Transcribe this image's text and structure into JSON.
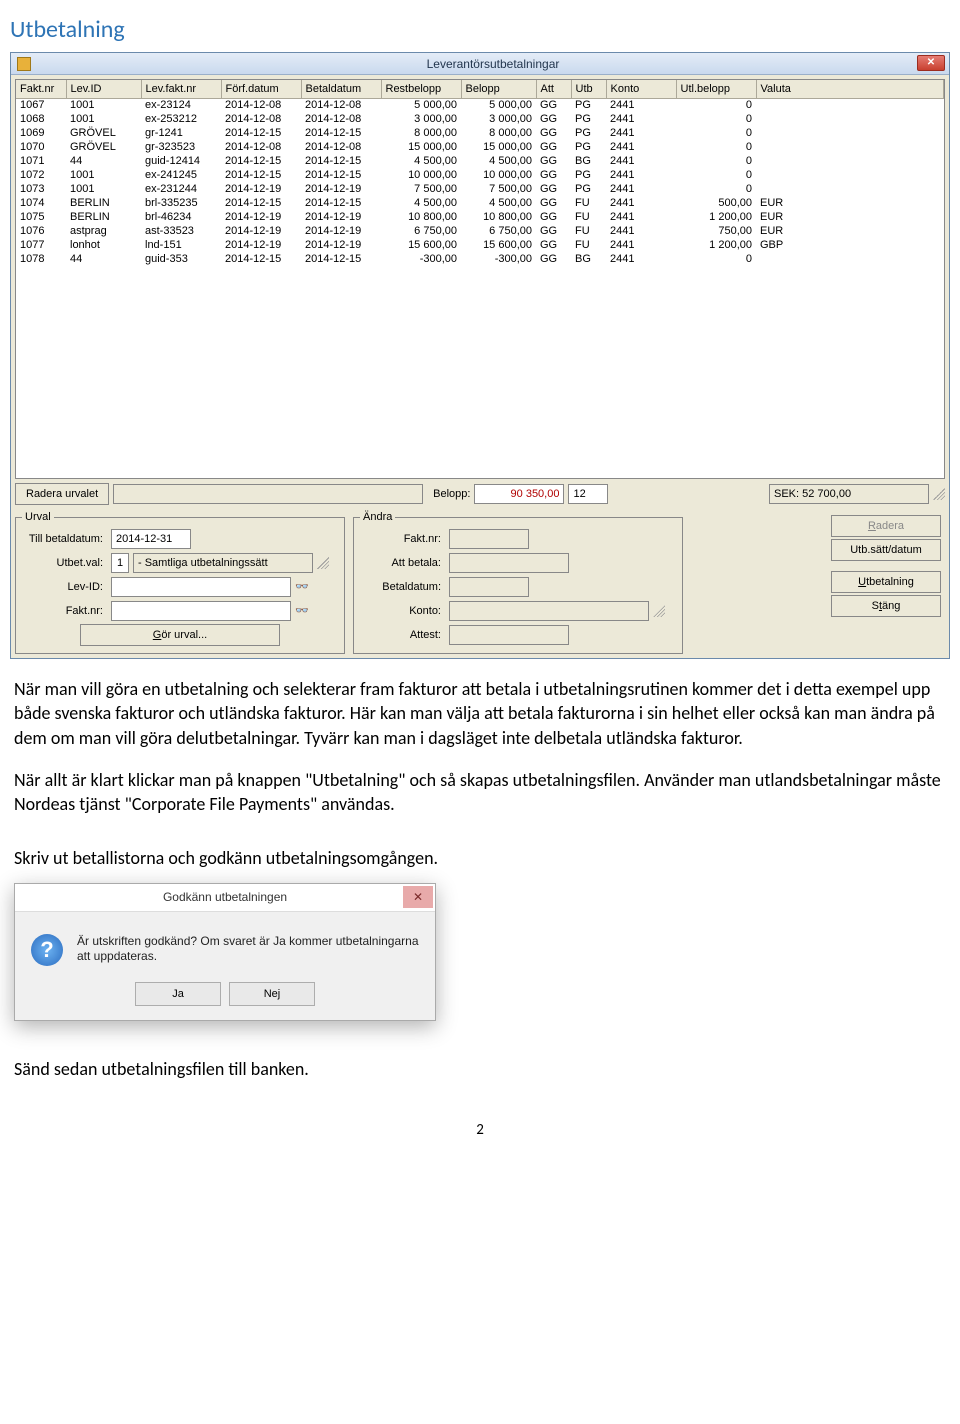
{
  "page_heading": "Utbetalning",
  "window": {
    "title": "Leverantörsutbetalningar",
    "close_glyph": "✕",
    "columns": [
      "Fakt.nr",
      "Lev.ID",
      "Lev.fakt.nr",
      "Förf.datum",
      "Betaldatum",
      "Restbelopp",
      "Belopp",
      "Att",
      "Utb",
      "Konto",
      "Utl.belopp",
      "Valuta"
    ],
    "rows": [
      {
        "faktnr": "1067",
        "levid": "1001",
        "levfaktnr": "ex-23124",
        "forf": "2014-12-08",
        "betal": "2014-12-08",
        "rest": "5 000,00",
        "belopp": "5 000,00",
        "att": "GG",
        "utb": "PG",
        "konto": "2441",
        "utl": "0",
        "valuta": ""
      },
      {
        "faktnr": "1068",
        "levid": "1001",
        "levfaktnr": "ex-253212",
        "forf": "2014-12-08",
        "betal": "2014-12-08",
        "rest": "3 000,00",
        "belopp": "3 000,00",
        "att": "GG",
        "utb": "PG",
        "konto": "2441",
        "utl": "0",
        "valuta": ""
      },
      {
        "faktnr": "1069",
        "levid": "GRÖVEL",
        "levfaktnr": "gr-1241",
        "forf": "2014-12-15",
        "betal": "2014-12-15",
        "rest": "8 000,00",
        "belopp": "8 000,00",
        "att": "GG",
        "utb": "PG",
        "konto": "2441",
        "utl": "0",
        "valuta": ""
      },
      {
        "faktnr": "1070",
        "levid": "GRÖVEL",
        "levfaktnr": "gr-323523",
        "forf": "2014-12-08",
        "betal": "2014-12-08",
        "rest": "15 000,00",
        "belopp": "15 000,00",
        "att": "GG",
        "utb": "PG",
        "konto": "2441",
        "utl": "0",
        "valuta": ""
      },
      {
        "faktnr": "1071",
        "levid": "44",
        "levfaktnr": "guid-12414",
        "forf": "2014-12-15",
        "betal": "2014-12-15",
        "rest": "4 500,00",
        "belopp": "4 500,00",
        "att": "GG",
        "utb": "BG",
        "konto": "2441",
        "utl": "0",
        "valuta": ""
      },
      {
        "faktnr": "1072",
        "levid": "1001",
        "levfaktnr": "ex-241245",
        "forf": "2014-12-15",
        "betal": "2014-12-15",
        "rest": "10 000,00",
        "belopp": "10 000,00",
        "att": "GG",
        "utb": "PG",
        "konto": "2441",
        "utl": "0",
        "valuta": ""
      },
      {
        "faktnr": "1073",
        "levid": "1001",
        "levfaktnr": "ex-231244",
        "forf": "2014-12-19",
        "betal": "2014-12-19",
        "rest": "7 500,00",
        "belopp": "7 500,00",
        "att": "GG",
        "utb": "PG",
        "konto": "2441",
        "utl": "0",
        "valuta": ""
      },
      {
        "faktnr": "1074",
        "levid": "BERLIN",
        "levfaktnr": "brl-335235",
        "forf": "2014-12-15",
        "betal": "2014-12-15",
        "rest": "4 500,00",
        "belopp": "4 500,00",
        "att": "GG",
        "utb": "FU",
        "konto": "2441",
        "utl": "500,00",
        "valuta": "EUR"
      },
      {
        "faktnr": "1075",
        "levid": "BERLIN",
        "levfaktnr": "brl-46234",
        "forf": "2014-12-19",
        "betal": "2014-12-19",
        "rest": "10 800,00",
        "belopp": "10 800,00",
        "att": "GG",
        "utb": "FU",
        "konto": "2441",
        "utl": "1 200,00",
        "valuta": "EUR"
      },
      {
        "faktnr": "1076",
        "levid": "astprag",
        "levfaktnr": "ast-33523",
        "forf": "2014-12-19",
        "betal": "2014-12-19",
        "rest": "6 750,00",
        "belopp": "6 750,00",
        "att": "GG",
        "utb": "FU",
        "konto": "2441",
        "utl": "750,00",
        "valuta": "EUR"
      },
      {
        "faktnr": "1077",
        "levid": "lonhot",
        "levfaktnr": "lnd-151",
        "forf": "2014-12-19",
        "betal": "2014-12-19",
        "rest": "15 600,00",
        "belopp": "15 600,00",
        "att": "GG",
        "utb": "FU",
        "konto": "2441",
        "utl": "1 200,00",
        "valuta": "GBP"
      },
      {
        "faktnr": "1078",
        "levid": "44",
        "levfaktnr": "guid-353",
        "forf": "2014-12-15",
        "betal": "2014-12-15",
        "rest": "-300,00",
        "belopp": "-300,00",
        "att": "GG",
        "utb": "BG",
        "konto": "2441",
        "utl": "0",
        "valuta": ""
      }
    ],
    "radera_urvalet_label": "Radera urvalet",
    "belopp_label": "Belopp:",
    "belopp_value": "90 350,00",
    "count_value": "12",
    "sek_value": "SEK: 52 700,00",
    "urval": {
      "legend": "Urval",
      "till_betaldatum_label": "Till betaldatum:",
      "till_betaldatum_value": "2014-12-31",
      "utbet_val_label": "Utbet.val:",
      "utbet_val_code": "1",
      "utbet_val_text": "- Samtliga utbetalningssätt",
      "lev_id_label": "Lev-ID:",
      "lev_id_value": "",
      "fakt_nr_label": "Fakt.nr:",
      "fakt_nr_value": "",
      "gor_urval_label": "Gör urval..."
    },
    "andra": {
      "legend": "Ändra",
      "fakt_nr_label": "Fakt.nr:",
      "att_betala_label": "Att betala:",
      "betaldatum_label": "Betaldatum:",
      "konto_label": "Konto:",
      "attest_label": "Attest:"
    },
    "side_buttons": {
      "radera": "Radera",
      "utb_satt": "Utb.sätt/datum",
      "utbetalning": "Utbetalning",
      "stang": "Stäng"
    }
  },
  "body_para1": "När man vill göra en utbetalning och selekterar fram fakturor att betala i utbetalningsrutinen kommer det i detta exempel upp både svenska fakturor och utländska fakturor. Här kan man välja att betala fakturorna i sin helhet eller också kan man ändra på dem om man vill göra delutbetalningar. Tyvärr kan man i dagsläget inte delbetala utländska fakturor.",
  "body_para2": "När allt är klart klickar man på knappen \"Utbetalning\" och så skapas utbetalningsfilen. Använder man utlandsbetalningar måste Nordeas tjänst \"Corporate File Payments\" användas.",
  "body_para3": "Skriv ut betallistorna och godkänn utbetalningsomgången.",
  "dialog": {
    "title": "Godkänn utbetalningen",
    "close_glyph": "✕",
    "text": "Är utskriften godkänd? Om svaret är Ja kommer utbetalningarna att uppdateras.",
    "yes": "Ja",
    "no": "Nej"
  },
  "body_para4": "Sänd sedan utbetalningsfilen till banken.",
  "page_number": "2",
  "glyphs": {
    "binoculars": "👓"
  }
}
